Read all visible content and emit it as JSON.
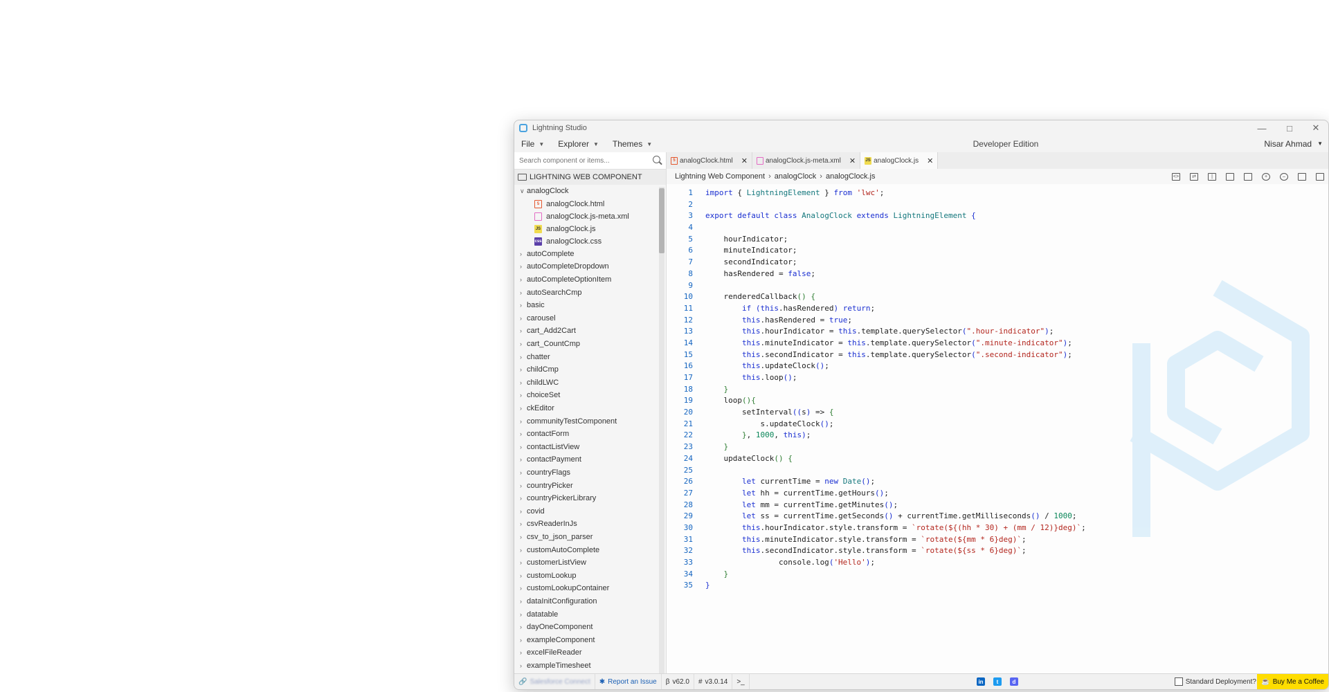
{
  "app": {
    "title": "Lightning Studio",
    "edition": "Developer Edition",
    "user": "Nisar Ahmad"
  },
  "menu": [
    "File",
    "Explorer",
    "Themes"
  ],
  "sidebar": {
    "search_placeholder": "Search component or items...",
    "section_title": "LIGHTNING WEB COMPONENT",
    "open_folder": "analogClock",
    "files": [
      {
        "name": "analogClock.html",
        "icon": "html-file-icon"
      },
      {
        "name": "analogClock.js-meta.xml",
        "icon": "xml-file-icon"
      },
      {
        "name": "analogClock.js",
        "icon": "js-file-icon"
      },
      {
        "name": "analogClock.css",
        "icon": "css-file-icon"
      }
    ],
    "folders": [
      "autoComplete",
      "autoCompleteDropdown",
      "autoCompleteOptionItem",
      "autoSearchCmp",
      "basic",
      "carousel",
      "cart_Add2Cart",
      "cart_CountCmp",
      "chatter",
      "childCmp",
      "childLWC",
      "choiceSet",
      "ckEditor",
      "communityTestComponent",
      "contactForm",
      "contactListView",
      "contactPayment",
      "countryFlags",
      "countryPicker",
      "countryPickerLibrary",
      "covid",
      "csvReaderInJs",
      "csv_to_json_parser",
      "customAutoComplete",
      "customerListView",
      "customLookup",
      "customLookupContainer",
      "dataInitConfiguration",
      "datatable",
      "dayOneComponent",
      "exampleComponent",
      "excelFileReader",
      "exampleTimesheet"
    ]
  },
  "tabs": [
    {
      "label": "analogClock.html",
      "icon": "html-file-icon",
      "active": false
    },
    {
      "label": "analogClock.js-meta.xml",
      "icon": "xml-file-icon",
      "active": false
    },
    {
      "label": "analogClock.js",
      "icon": "js-file-icon",
      "active": true
    }
  ],
  "breadcrumb": [
    "Lightning Web Component",
    "analogClock",
    "analogClock.js"
  ],
  "code": [
    [
      [
        "kw",
        "import"
      ],
      [
        "ct",
        " { "
      ],
      [
        "cls",
        "LightningElement"
      ],
      [
        "ct",
        " } "
      ],
      [
        "kw",
        "from"
      ],
      [
        "ct",
        " "
      ],
      [
        "str",
        "'lwc'"
      ],
      [
        "ct",
        ";"
      ]
    ],
    [],
    [
      [
        "kw",
        "export default class"
      ],
      [
        "ct",
        " "
      ],
      [
        "cls",
        "AnalogClock"
      ],
      [
        "ct",
        " "
      ],
      [
        "kw",
        "extends"
      ],
      [
        "ct",
        " "
      ],
      [
        "cls",
        "LightningElement"
      ],
      [
        "ct",
        " "
      ],
      [
        "br2",
        "{"
      ]
    ],
    [],
    [
      [
        "ct",
        "    hourIndicator;"
      ]
    ],
    [
      [
        "ct",
        "    minuteIndicator;"
      ]
    ],
    [
      [
        "ct",
        "    secondIndicator;"
      ]
    ],
    [
      [
        "ct",
        "    hasRendered = "
      ],
      [
        "kw",
        "false"
      ],
      [
        "ct",
        ";"
      ]
    ],
    [],
    [
      [
        "ct",
        "    renderedCallback"
      ],
      [
        "br",
        "()"
      ],
      [
        "ct",
        " "
      ],
      [
        "br",
        "{"
      ]
    ],
    [
      [
        "ct",
        "        "
      ],
      [
        "kw",
        "if"
      ],
      [
        "ct",
        " "
      ],
      [
        "br2",
        "("
      ],
      [
        "kw",
        "this"
      ],
      [
        "ct",
        ".hasRendered"
      ],
      [
        "br2",
        ")"
      ],
      [
        "ct",
        " "
      ],
      [
        "kw",
        "return"
      ],
      [
        "ct",
        ";"
      ]
    ],
    [
      [
        "ct",
        "        "
      ],
      [
        "kw",
        "this"
      ],
      [
        "ct",
        ".hasRendered = "
      ],
      [
        "kw",
        "true"
      ],
      [
        "ct",
        ";"
      ]
    ],
    [
      [
        "ct",
        "        "
      ],
      [
        "kw",
        "this"
      ],
      [
        "ct",
        ".hourIndicator = "
      ],
      [
        "kw",
        "this"
      ],
      [
        "ct",
        ".template.querySelector"
      ],
      [
        "br2",
        "("
      ],
      [
        "str",
        "\".hour-indicator\""
      ],
      [
        "br2",
        ")"
      ],
      [
        "ct",
        ";"
      ]
    ],
    [
      [
        "ct",
        "        "
      ],
      [
        "kw",
        "this"
      ],
      [
        "ct",
        ".minuteIndicator = "
      ],
      [
        "kw",
        "this"
      ],
      [
        "ct",
        ".template.querySelector"
      ],
      [
        "br2",
        "("
      ],
      [
        "str",
        "\".minute-indicator\""
      ],
      [
        "br2",
        ")"
      ],
      [
        "ct",
        ";"
      ]
    ],
    [
      [
        "ct",
        "        "
      ],
      [
        "kw",
        "this"
      ],
      [
        "ct",
        ".secondIndicator = "
      ],
      [
        "kw",
        "this"
      ],
      [
        "ct",
        ".template.querySelector"
      ],
      [
        "br2",
        "("
      ],
      [
        "str",
        "\".second-indicator\""
      ],
      [
        "br2",
        ")"
      ],
      [
        "ct",
        ";"
      ]
    ],
    [
      [
        "ct",
        "        "
      ],
      [
        "kw",
        "this"
      ],
      [
        "ct",
        ".updateClock"
      ],
      [
        "br2",
        "()"
      ],
      [
        "ct",
        ";"
      ]
    ],
    [
      [
        "ct",
        "        "
      ],
      [
        "kw",
        "this"
      ],
      [
        "ct",
        ".loop"
      ],
      [
        "br2",
        "()"
      ],
      [
        "ct",
        ";"
      ]
    ],
    [
      [
        "ct",
        "    "
      ],
      [
        "br",
        "}"
      ]
    ],
    [
      [
        "ct",
        "    loop"
      ],
      [
        "br",
        "()"
      ],
      [
        "br",
        "{"
      ]
    ],
    [
      [
        "ct",
        "        setInterval"
      ],
      [
        "br2",
        "(("
      ],
      [
        "ct",
        "s"
      ],
      [
        "br2",
        ")"
      ],
      [
        "ct",
        " => "
      ],
      [
        "br",
        "{"
      ]
    ],
    [
      [
        "ct",
        "            s.updateClock"
      ],
      [
        "br2",
        "()"
      ],
      [
        "ct",
        ";"
      ]
    ],
    [
      [
        "ct",
        "        "
      ],
      [
        "br",
        "}"
      ],
      [
        "ct",
        ", "
      ],
      [
        "num",
        "1000"
      ],
      [
        "ct",
        ", "
      ],
      [
        "kw",
        "this"
      ],
      [
        "br2",
        ")"
      ],
      [
        "ct",
        ";"
      ]
    ],
    [
      [
        "ct",
        "    "
      ],
      [
        "br",
        "}"
      ]
    ],
    [
      [
        "ct",
        "    updateClock"
      ],
      [
        "br",
        "()"
      ],
      [
        "ct",
        " "
      ],
      [
        "br",
        "{"
      ]
    ],
    [],
    [
      [
        "ct",
        "        "
      ],
      [
        "kw",
        "let"
      ],
      [
        "ct",
        " currentTime = "
      ],
      [
        "kw",
        "new"
      ],
      [
        "ct",
        " "
      ],
      [
        "cls",
        "Date"
      ],
      [
        "br2",
        "()"
      ],
      [
        "ct",
        ";"
      ]
    ],
    [
      [
        "ct",
        "        "
      ],
      [
        "kw",
        "let"
      ],
      [
        "ct",
        " hh = currentTime.getHours"
      ],
      [
        "br2",
        "()"
      ],
      [
        "ct",
        ";"
      ]
    ],
    [
      [
        "ct",
        "        "
      ],
      [
        "kw",
        "let"
      ],
      [
        "ct",
        " mm = currentTime.getMinutes"
      ],
      [
        "br2",
        "()"
      ],
      [
        "ct",
        ";"
      ]
    ],
    [
      [
        "ct",
        "        "
      ],
      [
        "kw",
        "let"
      ],
      [
        "ct",
        " ss = currentTime.getSeconds"
      ],
      [
        "br2",
        "()"
      ],
      [
        "ct",
        " + currentTime.getMilliseconds"
      ],
      [
        "br2",
        "()"
      ],
      [
        "ct",
        " / "
      ],
      [
        "num",
        "1000"
      ],
      [
        "ct",
        ";"
      ]
    ],
    [
      [
        "ct",
        "        "
      ],
      [
        "kw",
        "this"
      ],
      [
        "ct",
        ".hourIndicator.style.transform = "
      ],
      [
        "str",
        "`rotate(${(hh * 30) + (mm / 12)}deg)`"
      ],
      [
        "ct",
        ";"
      ]
    ],
    [
      [
        "ct",
        "        "
      ],
      [
        "kw",
        "this"
      ],
      [
        "ct",
        ".minuteIndicator.style.transform = "
      ],
      [
        "str",
        "`rotate(${mm * 6}deg)`"
      ],
      [
        "ct",
        ";"
      ]
    ],
    [
      [
        "ct",
        "        "
      ],
      [
        "kw",
        "this"
      ],
      [
        "ct",
        ".secondIndicator.style.transform = "
      ],
      [
        "str",
        "`rotate(${ss * 6}deg)`"
      ],
      [
        "ct",
        ";"
      ]
    ],
    [
      [
        "ct",
        "                console.log"
      ],
      [
        "br2",
        "("
      ],
      [
        "str",
        "'Hello'"
      ],
      [
        "br2",
        ")"
      ],
      [
        "ct",
        ";"
      ]
    ],
    [
      [
        "ct",
        "    "
      ],
      [
        "br",
        "}"
      ]
    ],
    [
      [
        "br2",
        "}"
      ]
    ]
  ],
  "status": {
    "blurred_link": "Salesforce Connect",
    "report": "Report an Issue",
    "api_version": "v62.0",
    "app_version": "v3.0.14",
    "deploy_label": "Standard Deployment?",
    "coffee": "Buy Me a Coffee"
  },
  "colors": {
    "accent": "#2ecc40",
    "link": "#1a5fb4",
    "coffee": "#ffdd00",
    "watermark": "#dbeefa"
  }
}
